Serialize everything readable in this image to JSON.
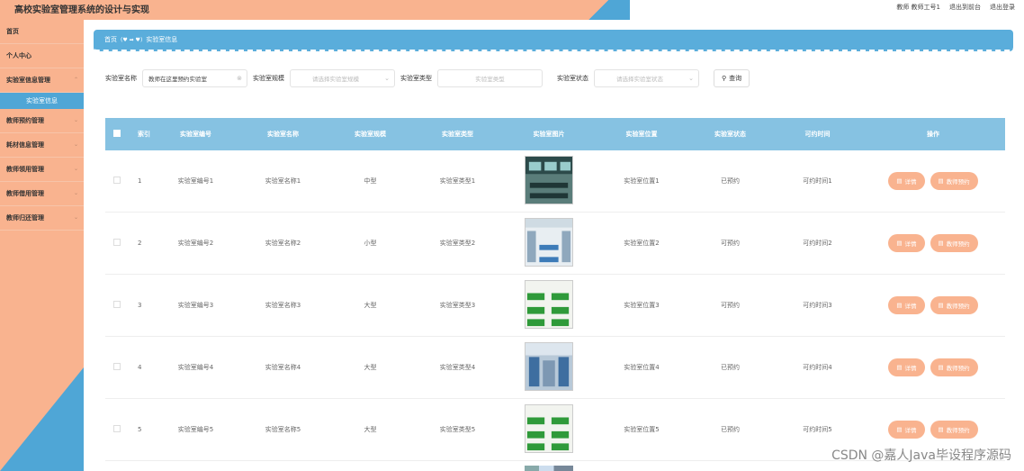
{
  "header": {
    "title": "高校实验室管理系统的设计与实现",
    "user_info": "教师 教师工号1",
    "back_link": "退出到前台",
    "logout_link": "退出登录"
  },
  "sidebar": {
    "items": [
      {
        "label": "首页"
      },
      {
        "label": "个人中心"
      },
      {
        "label": "实验室信息管理"
      },
      {
        "label": "教师预约管理"
      },
      {
        "label": "耗材信息管理"
      },
      {
        "label": "教师领用管理"
      },
      {
        "label": "教师借用管理"
      },
      {
        "label": "教师归还管理"
      }
    ],
    "active_sub": "实验室信息"
  },
  "breadcrumb": {
    "home": "首页",
    "current": "实验室信息"
  },
  "search": {
    "name_label": "实验室名称",
    "name_value": "教师在这里预约实验室",
    "size_label": "实验室规模",
    "size_placeholder": "请选择实验室规模",
    "type_label": "实验室类型",
    "type_placeholder": "实验室类型",
    "status_label": "实验室状态",
    "status_placeholder": "请选择实验室状态",
    "query_button": "查询"
  },
  "table": {
    "headers": {
      "index": "索引",
      "no": "实验室编号",
      "name": "实验室名称",
      "size": "实验室规模",
      "type": "实验室类型",
      "image": "实验室图片",
      "location": "实验室位置",
      "status": "实验室状态",
      "time": "可约时间",
      "actions": "操作"
    },
    "detail_button": "详情",
    "reserve_button": "教师预约",
    "rows": [
      {
        "index": "1",
        "no": "实验室编号1",
        "name": "实验室名称1",
        "size": "中型",
        "type": "实验室类型1",
        "location": "实验室位置1",
        "status": "已预约",
        "time": "可约时间1"
      },
      {
        "index": "2",
        "no": "实验室编号2",
        "name": "实验室名称2",
        "size": "小型",
        "type": "实验室类型2",
        "location": "实验室位置2",
        "status": "可预约",
        "time": "可约时间2"
      },
      {
        "index": "3",
        "no": "实验室编号3",
        "name": "实验室名称3",
        "size": "大型",
        "type": "实验室类型3",
        "location": "实验室位置3",
        "status": "可预约",
        "time": "可约时间3"
      },
      {
        "index": "4",
        "no": "实验室编号4",
        "name": "实验室名称4",
        "size": "大型",
        "type": "实验室类型4",
        "location": "实验室位置4",
        "status": "已预约",
        "time": "可约时间4"
      },
      {
        "index": "5",
        "no": "实验室编号5",
        "name": "实验室名称5",
        "size": "大型",
        "type": "实验室类型5",
        "location": "实验室位置5",
        "status": "已预约",
        "time": "可约时间5"
      }
    ]
  },
  "watermark": "CSDN @嘉人Java毕设程序源码",
  "colors": {
    "accent_orange": "#f9b38f",
    "accent_blue": "#4fa6d6",
    "table_header": "#86c2e2"
  }
}
